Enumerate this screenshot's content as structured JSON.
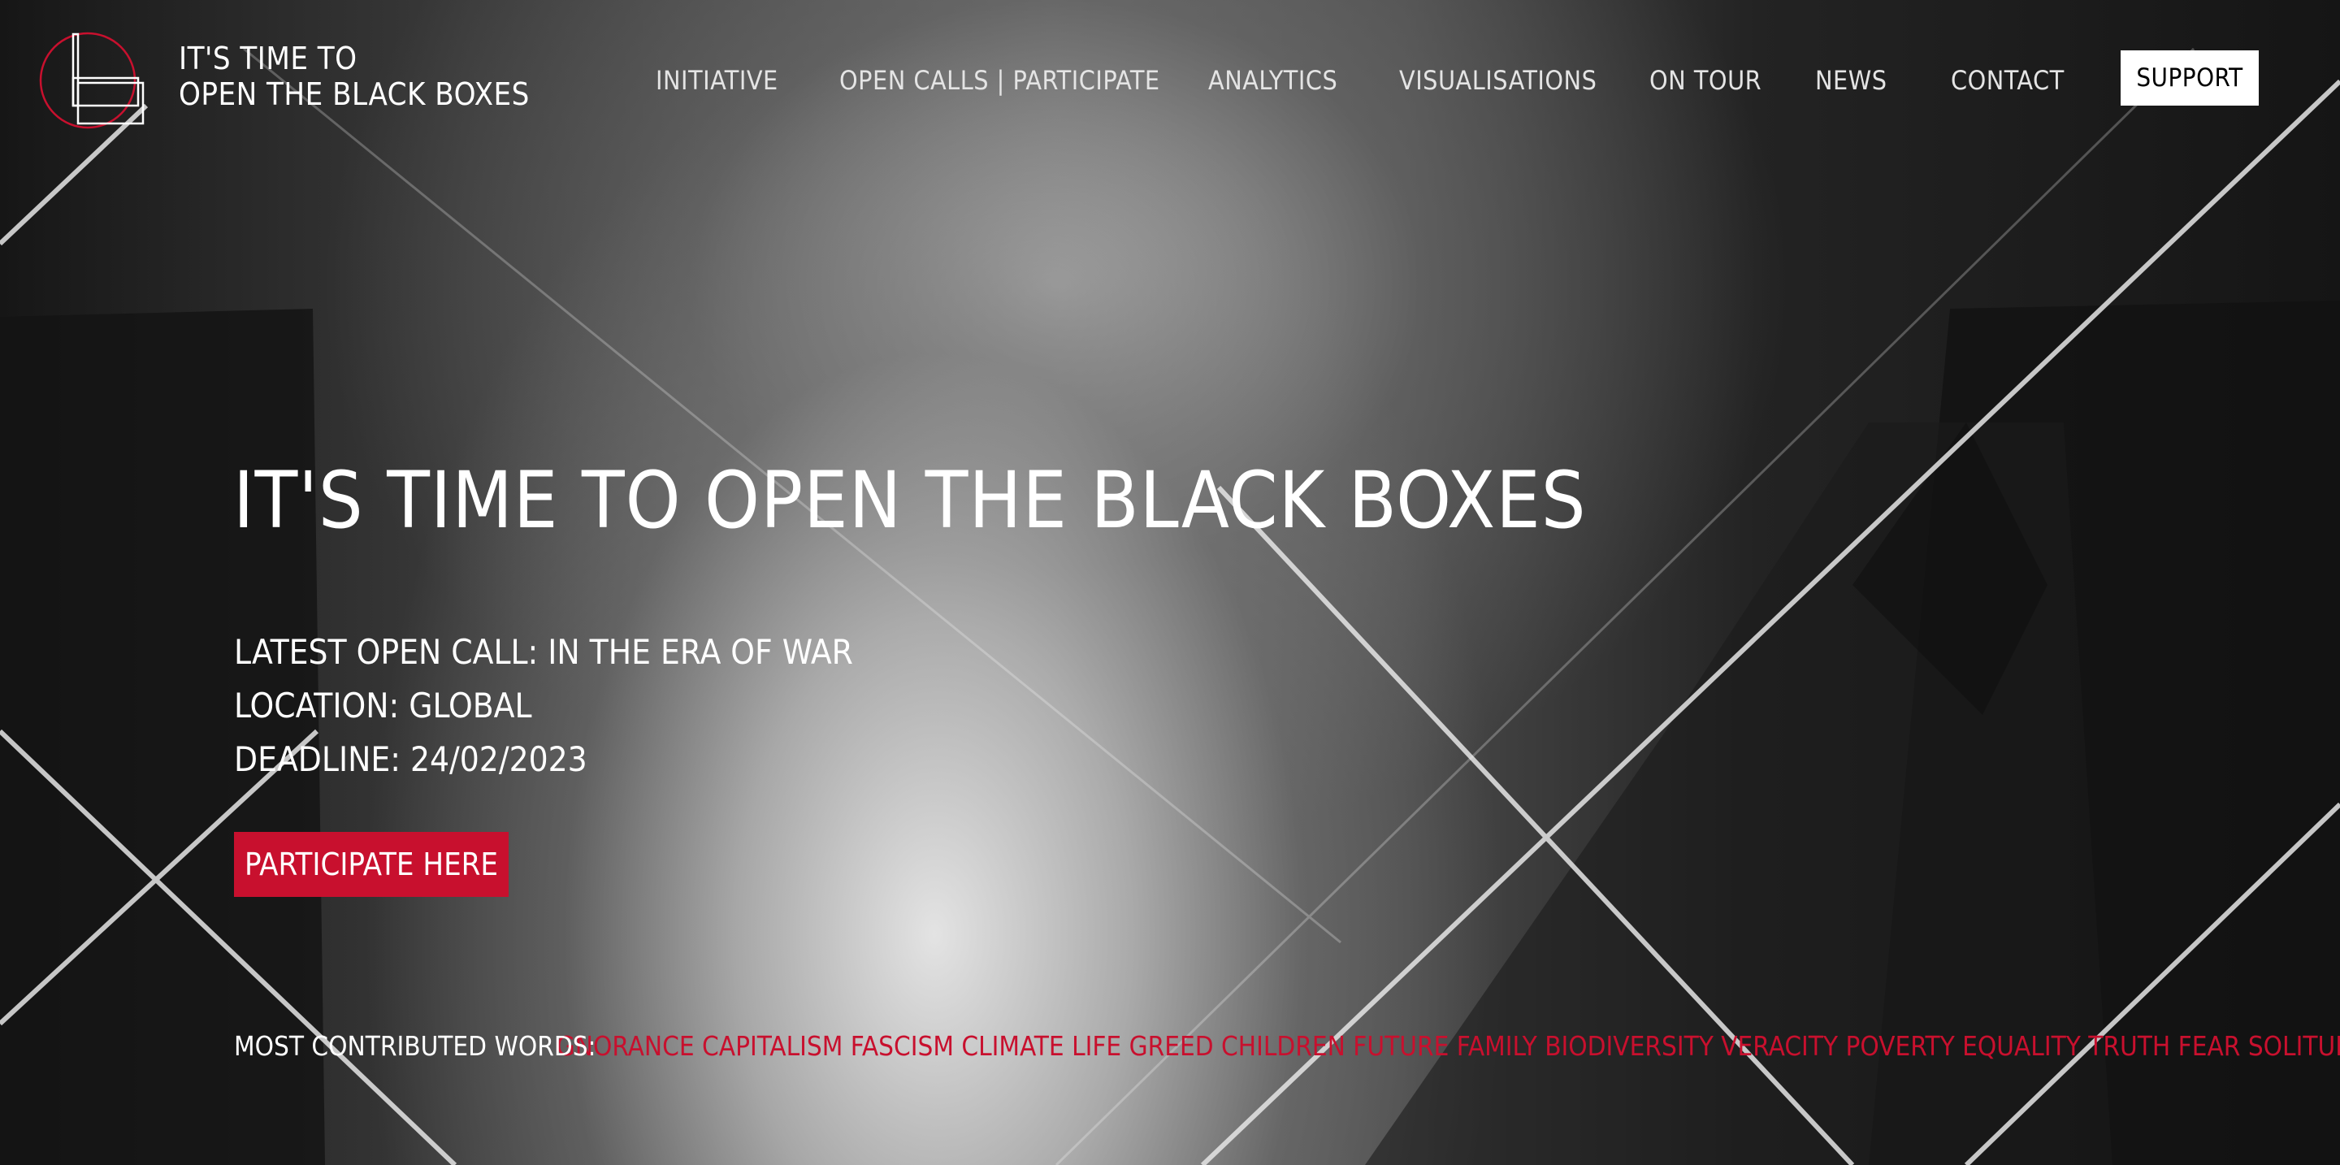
{
  "brand": {
    "line1": "IT'S TIME TO",
    "line2": "OPEN THE BLACK BOXES",
    "accent_color": "#c8102e"
  },
  "nav": {
    "items": [
      "INITIATIVE",
      "OPEN CALLS | PARTICIPATE",
      "ANALYTICS",
      "VISUALISATIONS",
      "ON TOUR",
      "NEWS",
      "CONTACT"
    ],
    "support_label": "SUPPORT"
  },
  "hero": {
    "title": "IT'S TIME TO OPEN THE BLACK BOXES",
    "latest_call": "LATEST OPEN CALL: IN THE ERA OF WAR",
    "location": "LOCATION: GLOBAL",
    "deadline": "DEADLINE: 24/02/2023",
    "cta_label": "PARTICIPATE HERE"
  },
  "words": {
    "label": "MOST CONTRIBUTED WORDS:",
    "ticker": "IGNORANCE CAPITALISM FASCISM CLIMATE LIFE GREED CHILDREN FUTURE FAMILY BIODIVERSITY VERACITY POVERTY EQUALITY TRUTH FEAR SOLITUDE REP"
  }
}
